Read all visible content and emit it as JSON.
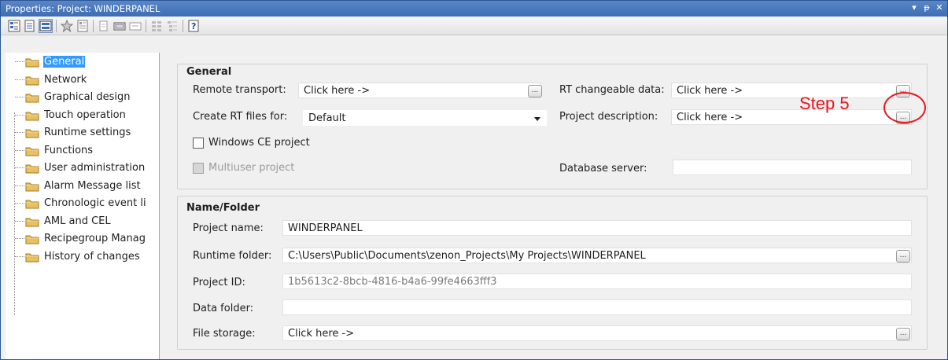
{
  "window": {
    "title": "Properties: Project: WINDERPANEL",
    "controls": [
      {
        "name": "dropdown-icon",
        "glyph": "▾"
      },
      {
        "name": "pin-icon",
        "glyph": "ᵽ"
      },
      {
        "name": "close-icon",
        "glyph": "✕"
      }
    ]
  },
  "toolbar": {
    "buttons": [
      "sort-category-icon",
      "sort-alpha-icon",
      "grouped-view-icon",
      "favorites-icon",
      "properties-page-icon",
      "expand-icon",
      "collapse-field-icon",
      "collapse-all-icon",
      "list-view-icon",
      "tree-view-icon",
      "help-icon"
    ]
  },
  "tree": {
    "items": [
      "General",
      "Network",
      "Graphical design",
      "Touch operation",
      "Runtime settings",
      "Functions",
      "User administration",
      "Alarm Message list",
      "Chronologic event li",
      "AML and CEL",
      "Recipegroup Manag",
      "History of changes"
    ],
    "selected_index": 0
  },
  "general": {
    "title": "General",
    "remote_transport_label": "Remote transport:",
    "remote_transport_value": "Click here ->",
    "rt_changeable_label": "RT changeable data:",
    "rt_changeable_value": "Click here ->",
    "create_rt_label": "Create RT files for:",
    "create_rt_value": "Default",
    "project_description_label": "Project description:",
    "project_description_value": "Click here ->",
    "windows_ce_label": "Windows CE project",
    "windows_ce_checked": false,
    "multiuser_label": "Multiuser project",
    "multiuser_checked": false,
    "database_server_label": "Database server:",
    "database_server_value": ""
  },
  "name_folder": {
    "title": "Name/Folder",
    "project_name_label": "Project name:",
    "project_name_value": "WINDERPANEL",
    "runtime_folder_label": "Runtime folder:",
    "runtime_folder_value": "C:\\Users\\Public\\Documents\\zenon_Projects\\My Projects\\WINDERPANEL",
    "project_id_label": "Project ID:",
    "project_id_value": "1b5613c2-8bcb-4816-b4a6-99fe4663fff3",
    "data_folder_label": "Data folder:",
    "data_folder_value": "",
    "file_storage_label": "File storage:",
    "file_storage_value": "Click here ->"
  },
  "ellipsis_label": "...",
  "annotation": {
    "text": "Step 5",
    "color": "#e8151b"
  },
  "colors": {
    "titlebar": "#3c6db4",
    "selection": "#3399ff",
    "folder": "#e8c064"
  }
}
